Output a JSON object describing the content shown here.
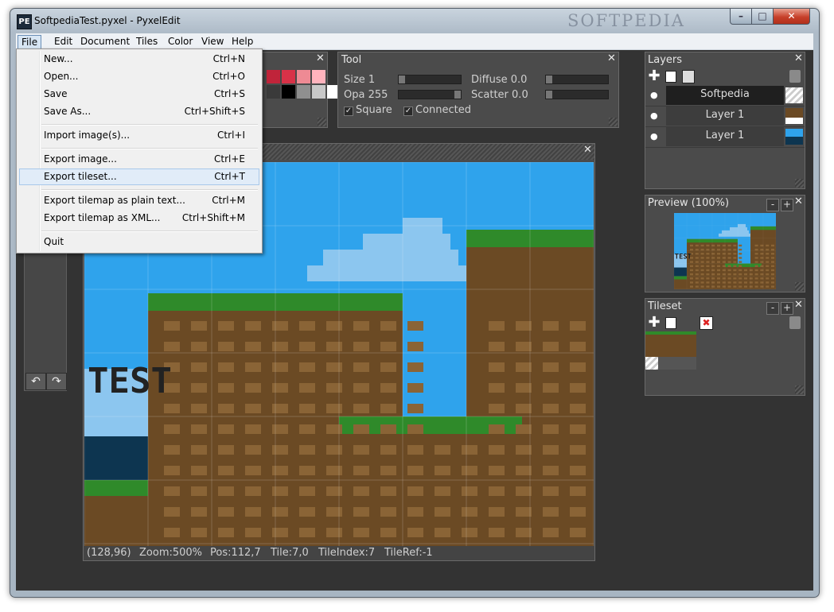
{
  "window": {
    "title": "SoftpediaTest.pyxel - PyxelEdit",
    "icon_text": "PE",
    "watermark": "SOFTPEDIA",
    "controls": {
      "minimize": "–",
      "maximize": "□",
      "close": "✕"
    }
  },
  "menubar": [
    "File",
    "Edit",
    "Document",
    "Tiles",
    "Color",
    "View",
    "Help"
  ],
  "file_menu": {
    "items": [
      {
        "label": "New...",
        "shortcut": "Ctrl+N"
      },
      {
        "label": "Open...",
        "shortcut": "Ctrl+O"
      },
      {
        "label": "Save",
        "shortcut": "Ctrl+S"
      },
      {
        "label": "Save As...",
        "shortcut": "Ctrl+Shift+S"
      },
      {
        "label": "Import image(s)...",
        "shortcut": "Ctrl+I"
      },
      {
        "label": "Export image...",
        "shortcut": "Ctrl+E"
      },
      {
        "label": "Export tileset...",
        "shortcut": "Ctrl+T"
      },
      {
        "label": "Export tilemap as plain text...",
        "shortcut": "Ctrl+M"
      },
      {
        "label": "Export tilemap as XML...",
        "shortcut": "Ctrl+Shift+M"
      },
      {
        "label": "Quit",
        "shortcut": ""
      }
    ],
    "highlighted": "Export tileset..."
  },
  "tool_panel": {
    "title": "Tool",
    "size_label": "Size 1",
    "opa_label": "Opa 255",
    "diffuse_label": "Diffuse 0.0",
    "scatter_label": "Scatter 0.0",
    "square_label": "Square",
    "connected_label": "Connected",
    "square_checked": true,
    "connected_checked": true,
    "close": "✕"
  },
  "palette_panel": {
    "close": "✕",
    "colors": [
      "#c0243a",
      "#d83248",
      "#ee8a94",
      "#ffb3bd",
      "#3a3a3a",
      "#000000",
      "#8f8f8f",
      "#c8c8c8",
      "#ffffff"
    ]
  },
  "layers_panel": {
    "title": "Layers",
    "close": "✕",
    "layers": [
      {
        "name": "Softpedia",
        "selected": true
      },
      {
        "name": "Layer 1",
        "selected": false
      },
      {
        "name": "Layer 1",
        "selected": false
      }
    ]
  },
  "preview_panel": {
    "title": "Preview (100%)",
    "minus": "-",
    "plus": "+",
    "close": "✕"
  },
  "tileset_panel": {
    "title": "Tileset",
    "minus": "-",
    "plus": "+",
    "close": "✕"
  },
  "canvas": {
    "close": "✕",
    "text_art": "TEST",
    "colors": {
      "sky": "#2fa3ec",
      "cloud": "#8cc6ef",
      "grass": "#2f8a2a",
      "dirt": "#6b4a24",
      "dirt_light": "#8a6436",
      "water": "#0d3550"
    }
  },
  "status_bar": {
    "coords": "(128,96)",
    "zoom": "Zoom:500%",
    "pos": "Pos:112,7",
    "tile": "Tile:7,0",
    "tile_index": "TileIndex:7",
    "tile_ref": "TileRef:-1"
  },
  "left_toolbar": {
    "undo": "↶",
    "redo": "↷"
  }
}
